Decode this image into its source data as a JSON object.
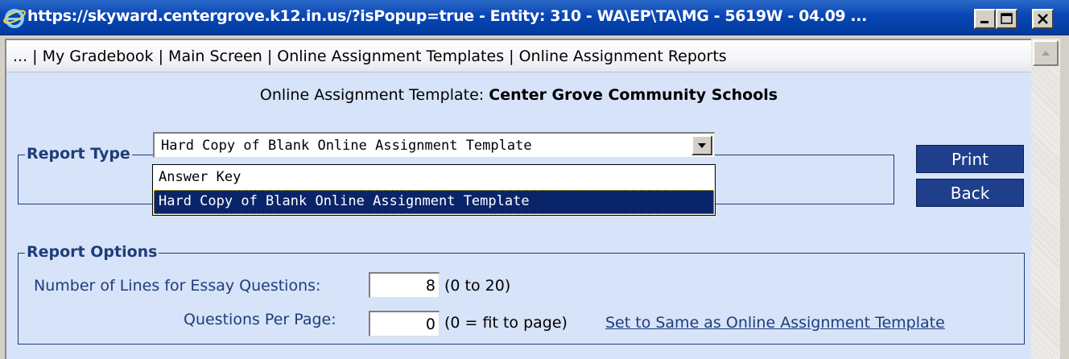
{
  "window": {
    "title": "https://skyward.centergrove.k12.in.us/?isPopup=true - Entity: 310 - WA\\EP\\TA\\MG - 5619W - 04.09 ...",
    "controls": {
      "minimize_icon": "minimize-icon",
      "maximize_icon": "maximize-icon",
      "close_icon": "close-icon"
    }
  },
  "nav": {
    "items": [
      "...",
      "My Gradebook",
      "Main Screen",
      "Online Assignment Templates",
      "Online Assignment Reports"
    ],
    "separator": "|"
  },
  "heading": {
    "prefix": "Online Assignment Template: ",
    "school": "Center Grove Community Schools"
  },
  "report_type": {
    "legend": "Report Type",
    "selected": "Hard Copy of Blank Online Assignment Template",
    "options": [
      "Answer Key",
      "Hard Copy of Blank Online Assignment Template"
    ],
    "highlighted_option": "Hard Copy of Blank Online Assignment Template"
  },
  "buttons": {
    "print": "Print",
    "back": "Back"
  },
  "report_options": {
    "legend": "Report Options",
    "essay_lines": {
      "label": "Number of Lines for Essay Questions:",
      "value": "8",
      "hint": "(0 to 20)"
    },
    "questions_per_page": {
      "label": "Questions Per Page:",
      "value": "0",
      "hint": "(0 = fit to page)"
    },
    "link": "Set to Same as Online Assignment Template"
  },
  "colors": {
    "title_bar": "#0a46b4",
    "content_bg": "#d7e3f8",
    "accent": "#1e3d7a",
    "button_bg": "#1f3f8c",
    "selection": "#0a246a"
  }
}
